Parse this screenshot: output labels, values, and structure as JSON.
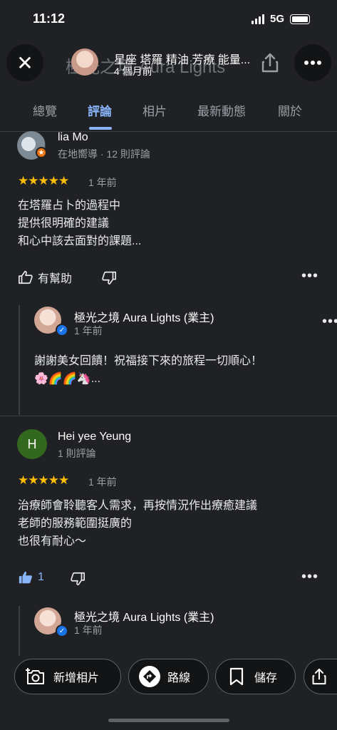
{
  "status": {
    "time": "11:12",
    "network": "5G"
  },
  "header": {
    "ghost_title": "極光之境 Aura Lights",
    "place_name": "星座 塔羅 精油 芳療 能量...",
    "posted": "4 個月前"
  },
  "tabs": [
    {
      "label": "總覽"
    },
    {
      "label": "評論"
    },
    {
      "label": "相片"
    },
    {
      "label": "最新動態"
    },
    {
      "label": "關於"
    }
  ],
  "reviews": [
    {
      "name": "lia Mo",
      "meta": "在地嚮導 · 12 則評論",
      "stars": "★★★★★",
      "rating": 5,
      "ago": "1 年前",
      "lines": [
        "在塔羅占卜的過程中",
        "提供很明確的建議",
        "和心中該去面對的課題..."
      ],
      "helpful_label": "有幫助",
      "owner": {
        "name": "極光之境 Aura Lights (業主)",
        "ago": "1 年前",
        "lines": [
          "謝謝美女回饋！祝福接下來的旅程一切順心！",
          "🌸🌈🌈🦄..."
        ]
      }
    },
    {
      "name": "Hei yee Yeung",
      "initial": "H",
      "meta": "1 則評論",
      "stars": "★★★★★",
      "rating": 5,
      "ago": "1 年前",
      "lines": [
        "治療師會聆聽客人需求，再按情況作出療癒建議",
        "老師的服務範圍挺廣的",
        "也很有耐心～"
      ],
      "likes": "1",
      "owner": {
        "name": "極光之境 Aura Lights (業主)",
        "ago": "1 年前"
      }
    }
  ],
  "actions": {
    "add_photo": "新增相片",
    "directions": "路線",
    "save": "儲存"
  },
  "colors": {
    "accent": "#8ab4f8",
    "star": "#fbbc04",
    "background": "#202124"
  }
}
